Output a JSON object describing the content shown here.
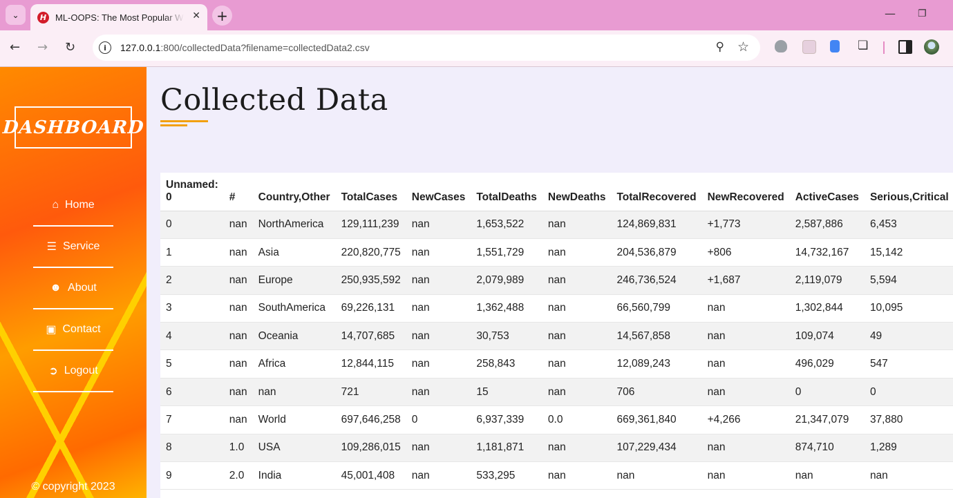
{
  "browser": {
    "tab_title": "ML-OOPS: The Most Popular W",
    "favicon_letter": "H",
    "url_host": "127.0.0.1",
    "url_rest": ":800/collectedData?filename=collectedData2.csv",
    "icons": [
      "tab-search-icon",
      "close-icon",
      "new-tab-icon",
      "back-icon",
      "forward-icon",
      "reload-icon",
      "info-icon",
      "zoom-icon",
      "star-icon",
      "extension-icon",
      "side-panel-icon",
      "profile-icon"
    ]
  },
  "sidebar": {
    "logo": "DASHBOARD",
    "items": [
      {
        "label": "Home",
        "icon": "home-icon"
      },
      {
        "label": "Service",
        "icon": "list-icon"
      },
      {
        "label": "About",
        "icon": "user-icon"
      },
      {
        "label": "Contact",
        "icon": "chat-icon"
      },
      {
        "label": "Logout",
        "icon": "logout-icon"
      }
    ],
    "copyright": "© copyright 2023"
  },
  "main": {
    "title": "Collected Data",
    "accent_color": "#f2a010"
  },
  "table": {
    "headers": [
      "Unnamed: 0",
      "#",
      "Country,Other",
      "TotalCases",
      "NewCases",
      "TotalDeaths",
      "NewDeaths",
      "TotalRecovered",
      "NewRecovered",
      "ActiveCases",
      "Serious,Critical"
    ],
    "rows": [
      [
        "0",
        "nan",
        "NorthAmerica",
        "129,111,239",
        "nan",
        "1,653,522",
        "nan",
        "124,869,831",
        "+1,773",
        "2,587,886",
        "6,453"
      ],
      [
        "1",
        "nan",
        "Asia",
        "220,820,775",
        "nan",
        "1,551,729",
        "nan",
        "204,536,879",
        "+806",
        "14,732,167",
        "15,142"
      ],
      [
        "2",
        "nan",
        "Europe",
        "250,935,592",
        "nan",
        "2,079,989",
        "nan",
        "246,736,524",
        "+1,687",
        "2,119,079",
        "5,594"
      ],
      [
        "3",
        "nan",
        "SouthAmerica",
        "69,226,131",
        "nan",
        "1,362,488",
        "nan",
        "66,560,799",
        "nan",
        "1,302,844",
        "10,095"
      ],
      [
        "4",
        "nan",
        "Oceania",
        "14,707,685",
        "nan",
        "30,753",
        "nan",
        "14,567,858",
        "nan",
        "109,074",
        "49"
      ],
      [
        "5",
        "nan",
        "Africa",
        "12,844,115",
        "nan",
        "258,843",
        "nan",
        "12,089,243",
        "nan",
        "496,029",
        "547"
      ],
      [
        "6",
        "nan",
        "nan",
        "721",
        "nan",
        "15",
        "nan",
        "706",
        "nan",
        "0",
        "0"
      ],
      [
        "7",
        "nan",
        "World",
        "697,646,258",
        "0",
        "6,937,339",
        "0.0",
        "669,361,840",
        "+4,266",
        "21,347,079",
        "37,880"
      ],
      [
        "8",
        "1.0",
        "USA",
        "109,286,015",
        "nan",
        "1,181,871",
        "nan",
        "107,229,434",
        "nan",
        "874,710",
        "1,289"
      ],
      [
        "9",
        "2.0",
        "India",
        "45,001,408",
        "nan",
        "533,295",
        "nan",
        "nan",
        "nan",
        "nan",
        "nan"
      ]
    ]
  }
}
